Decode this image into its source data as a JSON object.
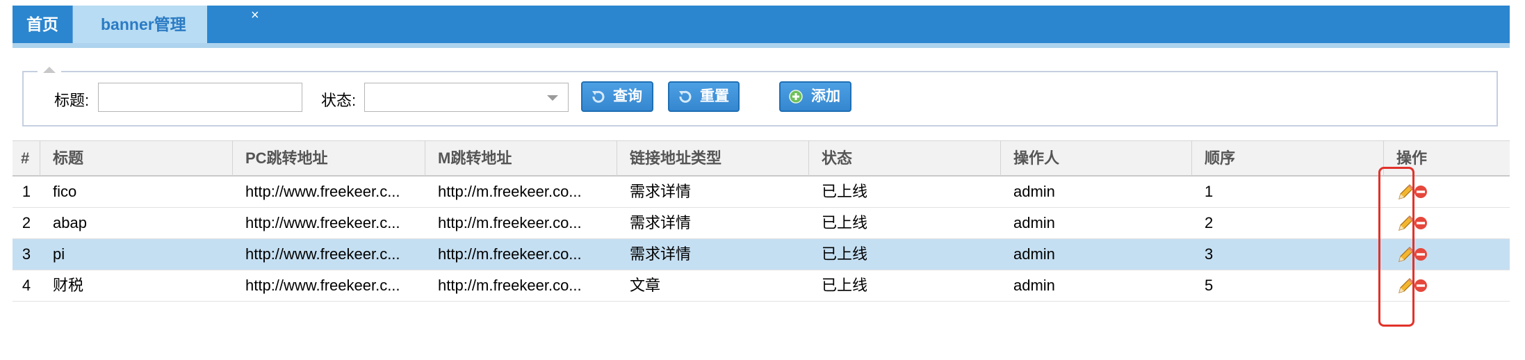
{
  "tabs": [
    {
      "label": "首页"
    },
    {
      "label": "banner管理",
      "close": "×"
    }
  ],
  "search": {
    "title_label": "标题:",
    "title_value": "",
    "status_label": "状态:",
    "status_value": "",
    "query_button": "查询",
    "reset_button": "重置",
    "add_button": "添加"
  },
  "table": {
    "headers": [
      "#",
      "标题",
      "PC跳转地址",
      "M跳转地址",
      "链接地址类型",
      "状态",
      "操作人",
      "顺序",
      "操作"
    ],
    "rows": [
      {
        "index": "1",
        "title": "fico",
        "pc_url": "http://www.freekeer.c...",
        "m_url": "http://m.freekeer.co...",
        "link_type": "需求详情",
        "status": "已上线",
        "operator": "admin",
        "order": "1",
        "selected": false
      },
      {
        "index": "2",
        "title": "abap",
        "pc_url": "http://www.freekeer.c...",
        "m_url": "http://m.freekeer.co...",
        "link_type": "需求详情",
        "status": "已上线",
        "operator": "admin",
        "order": "2",
        "selected": false
      },
      {
        "index": "3",
        "title": "pi",
        "pc_url": "http://www.freekeer.c...",
        "m_url": "http://m.freekeer.co...",
        "link_type": "需求详情",
        "status": "已上线",
        "operator": "admin",
        "order": "3",
        "selected": true
      },
      {
        "index": "4",
        "title": "财税",
        "pc_url": "http://www.freekeer.c...",
        "m_url": "http://m.freekeer.co...",
        "link_type": "文章",
        "status": "已上线",
        "operator": "admin",
        "order": "5",
        "selected": false
      }
    ]
  },
  "icons": {
    "edit": "pencil-icon",
    "delete": "delete-circle-icon",
    "query": "undo-arrow-icon",
    "reset": "undo-arrow-icon",
    "add": "plus-circle-icon"
  },
  "colors": {
    "tabbar": "#2b86cf",
    "active_tab": "#b8dcf3",
    "selected_row": "#c5dff2",
    "annotation": "#e2322a"
  }
}
